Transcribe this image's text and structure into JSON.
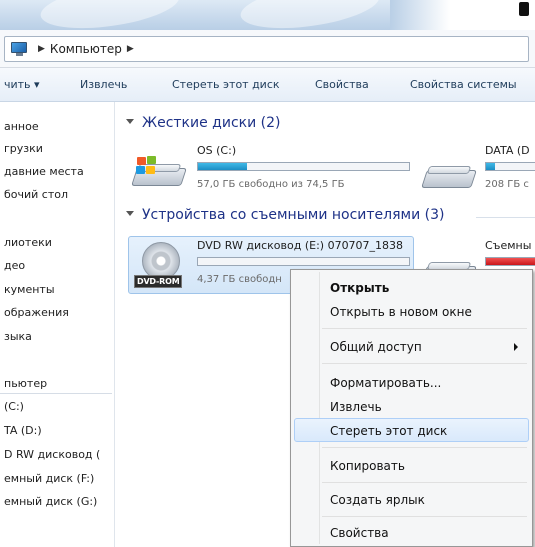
{
  "address": {
    "location": "Компьютер"
  },
  "toolbar": {
    "items": [
      "чить ▾",
      "Извлечь",
      "Стереть этот диск",
      "Свойства",
      "Свойства системы"
    ]
  },
  "nav": {
    "favorites": [
      "анное",
      "грузки",
      "давние места",
      "бочий стол"
    ],
    "libraries": [
      "лиотеки",
      "део",
      "кументы",
      "ображения",
      "зыка"
    ],
    "computer": [
      "пьютер",
      "(C:)",
      "TA (D:)",
      "D RW дисковод (",
      "емный диск (F:)",
      "емный диск (G:)"
    ]
  },
  "groups": {
    "hard_disks": "Жесткие диски (2)",
    "removable": "Устройства со съемными носителями (3)"
  },
  "drives": {
    "c": {
      "name": "OS (C:)",
      "free": "57,0 ГБ свободно из 74,5 ГБ",
      "used_fraction": 0.23
    },
    "d": {
      "name": "DATA (D",
      "free": "208 ГБ с",
      "used_fraction": 0.15
    },
    "e": {
      "name": "DVD RW дисковод (E:) 070707_1838",
      "free": "4,37 ГБ свободн",
      "badge": "DVD-ROM",
      "used_fraction": 0.0
    },
    "f": {
      "name": "Съемны",
      "used_fraction": 0.9
    }
  },
  "context_menu": {
    "open": "Открыть",
    "open_new_window": "Открыть в новом окне",
    "share": "Общий доступ",
    "format": "Форматировать...",
    "eject": "Извлечь",
    "erase": "Стереть этот диск",
    "copy": "Копировать",
    "shortcut": "Создать ярлык",
    "properties": "Свойства"
  },
  "colors": {
    "accent_link": "#1e3287",
    "bar_fill": "#2aa3d8",
    "bar_full": "#d6242a",
    "selection": "#d4e6f8"
  }
}
